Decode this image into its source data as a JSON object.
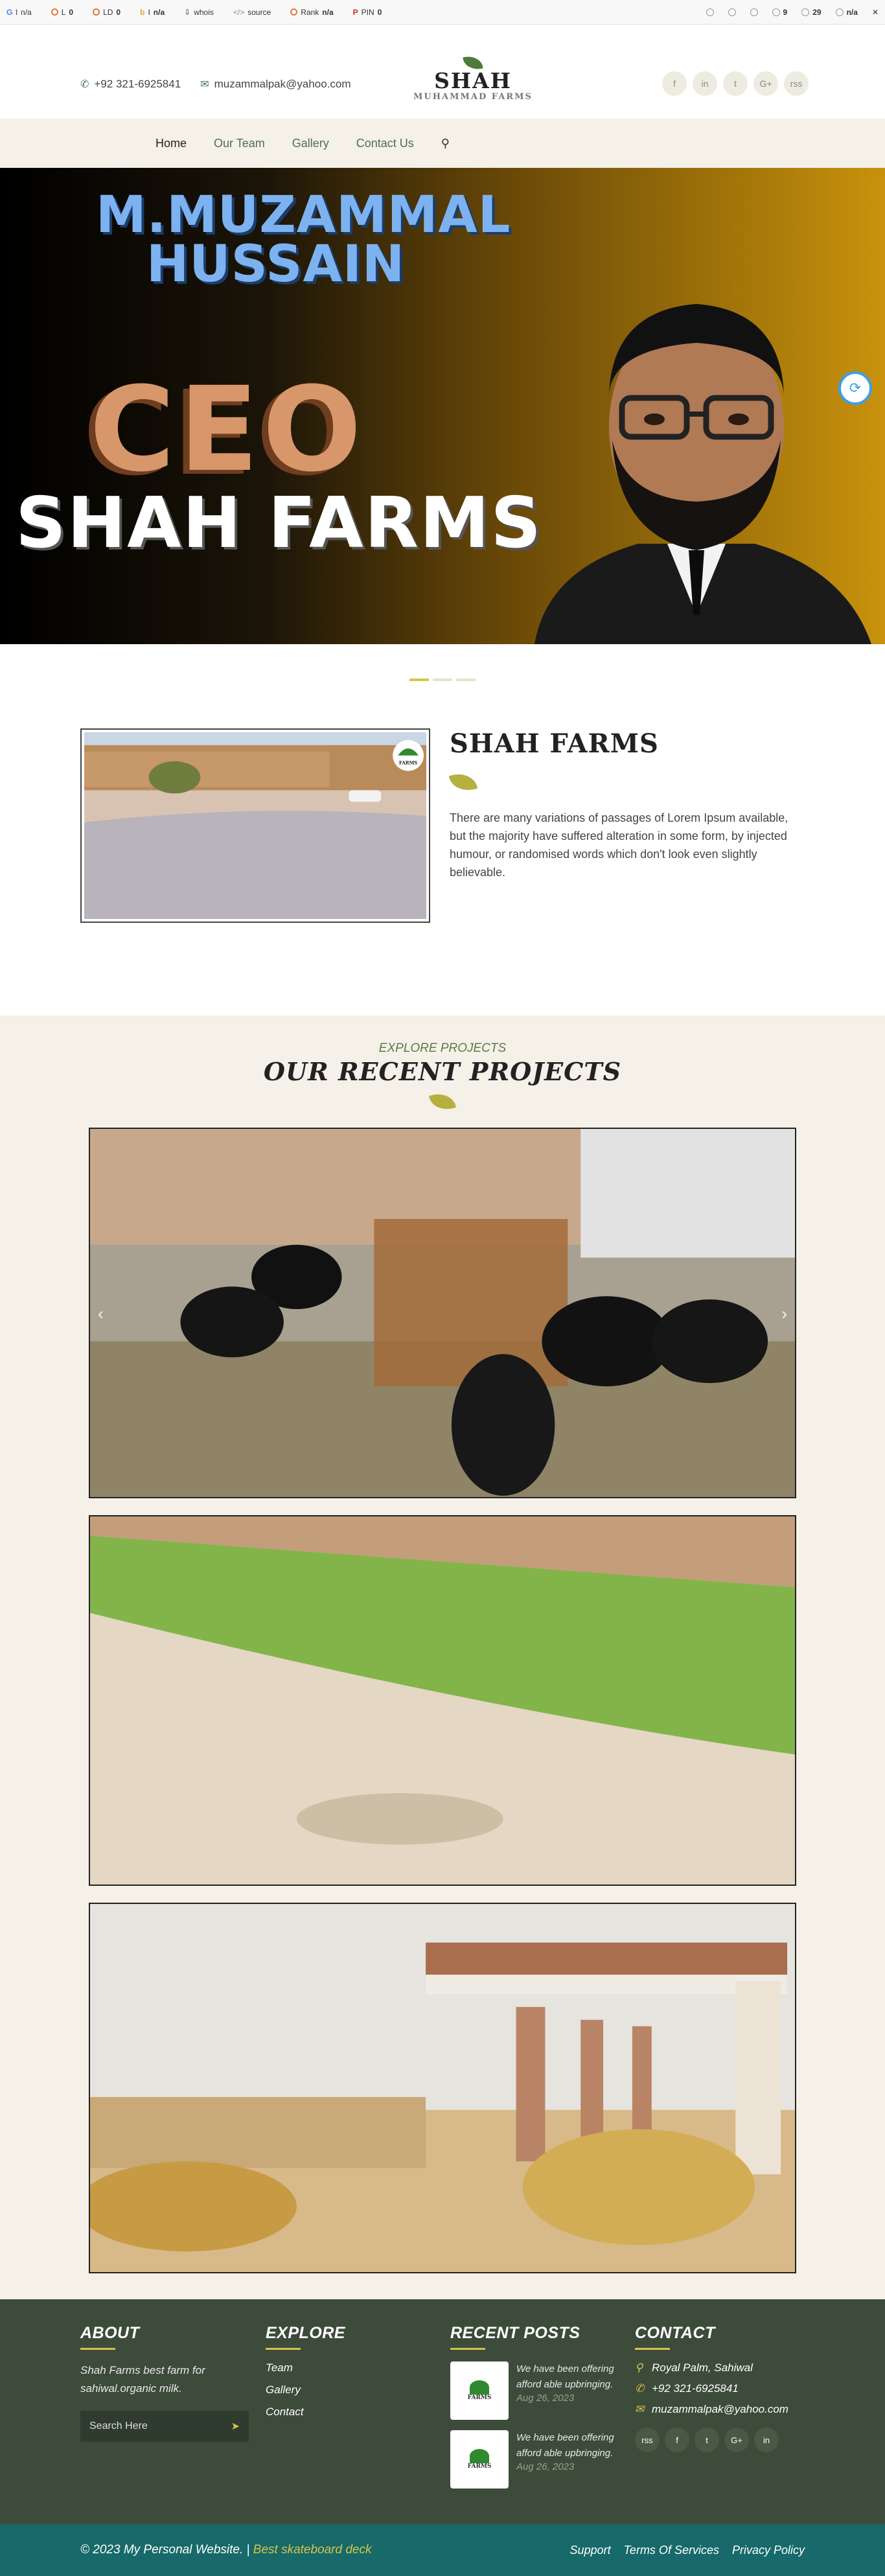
{
  "seo_bar": {
    "items": [
      {
        "icon": "google-icon",
        "label": "l",
        "value": "n/a"
      },
      {
        "icon": "l-icon",
        "label": "L",
        "value": "0"
      },
      {
        "icon": "ld-icon",
        "label": "LD",
        "value": "0"
      },
      {
        "icon": "b-icon",
        "label": "I",
        "value": "n/a"
      },
      {
        "icon": "whois-icon",
        "label": "whois",
        "value": ""
      },
      {
        "icon": "source-icon",
        "label": "source",
        "value": ""
      },
      {
        "icon": "rank-icon",
        "label": "Rank",
        "value": "n/a"
      },
      {
        "icon": "pin-icon",
        "label": "PIN",
        "value": "0"
      }
    ],
    "right": [
      {
        "icon": "ext-icon-1",
        "value": ""
      },
      {
        "icon": "ext-icon-2",
        "value": ""
      },
      {
        "icon": "ext-icon-3",
        "value": ""
      },
      {
        "icon": "ext-icon-4",
        "value": "9"
      },
      {
        "icon": "ext-icon-5",
        "value": "29"
      },
      {
        "icon": "ext-icon-6",
        "value": "n/a"
      }
    ]
  },
  "header": {
    "phone": "+92 321-6925841",
    "email": "muzammalpak@yahoo.com",
    "logo_big": "SHAH",
    "logo_small": "MUHAMMAD FARMS",
    "socials": [
      "f",
      "in",
      "t",
      "G+",
      "rss"
    ]
  },
  "nav": {
    "items": [
      {
        "label": "Home",
        "active": true
      },
      {
        "label": "Our Team"
      },
      {
        "label": "Gallery"
      },
      {
        "label": "Contact Us"
      }
    ]
  },
  "hero": {
    "name_line1": "M.MUZAMMAL",
    "name_line2": "HUSSAIN",
    "role": "CEO",
    "company": "SHAH FARMS"
  },
  "about": {
    "title": "SHAH FARMS",
    "description": "There are many variations of passages of Lorem Ipsum available, but the majority have suffered alteration in some form, by injected humour, or randomised words which don't look even slightly believable.",
    "photo_badge": "FARMS"
  },
  "projects": {
    "subtitle": "EXPLORE PROJECTS",
    "title": "OUR RECENT PROJECTS",
    "prev_arrow": "‹",
    "next_arrow": "›"
  },
  "footer": {
    "about": {
      "title": "ABOUT",
      "text": "Shah Farms best farm for sahiwal.organic milk.",
      "search_placeholder": "Search Here"
    },
    "explore": {
      "title": "EXPLORE",
      "links": [
        "Team",
        "Gallery",
        "Contact"
      ]
    },
    "recent": {
      "title": "RECENT POSTS",
      "posts": [
        {
          "text": "We have been offering afford able upbringing.",
          "date": "Aug 26, 2023",
          "thumb_label": "FARMS"
        },
        {
          "text": "We have been offering afford able upbringing.",
          "date": "Aug 26, 2023",
          "thumb_label": "FARMS"
        }
      ]
    },
    "contact": {
      "title": "CONTACT",
      "address": "Royal Palm, Sahiwal",
      "phone": "+92 321-6925841",
      "email": "muzammalpak@yahoo.com",
      "socials": [
        "rss",
        "f",
        "t",
        "G+",
        "in"
      ]
    }
  },
  "bottom": {
    "copyright": "© 2023 My Personal Website. | ",
    "link": "Best skateboard deck",
    "links": [
      "Support",
      "Terms Of Services",
      "Privacy Policy"
    ]
  },
  "colors": {
    "accent_green": "#4f6f52",
    "accent_gold": "#d7c44a",
    "footer_bg": "#3d4b3b",
    "bottombar_bg": "#176a69"
  }
}
